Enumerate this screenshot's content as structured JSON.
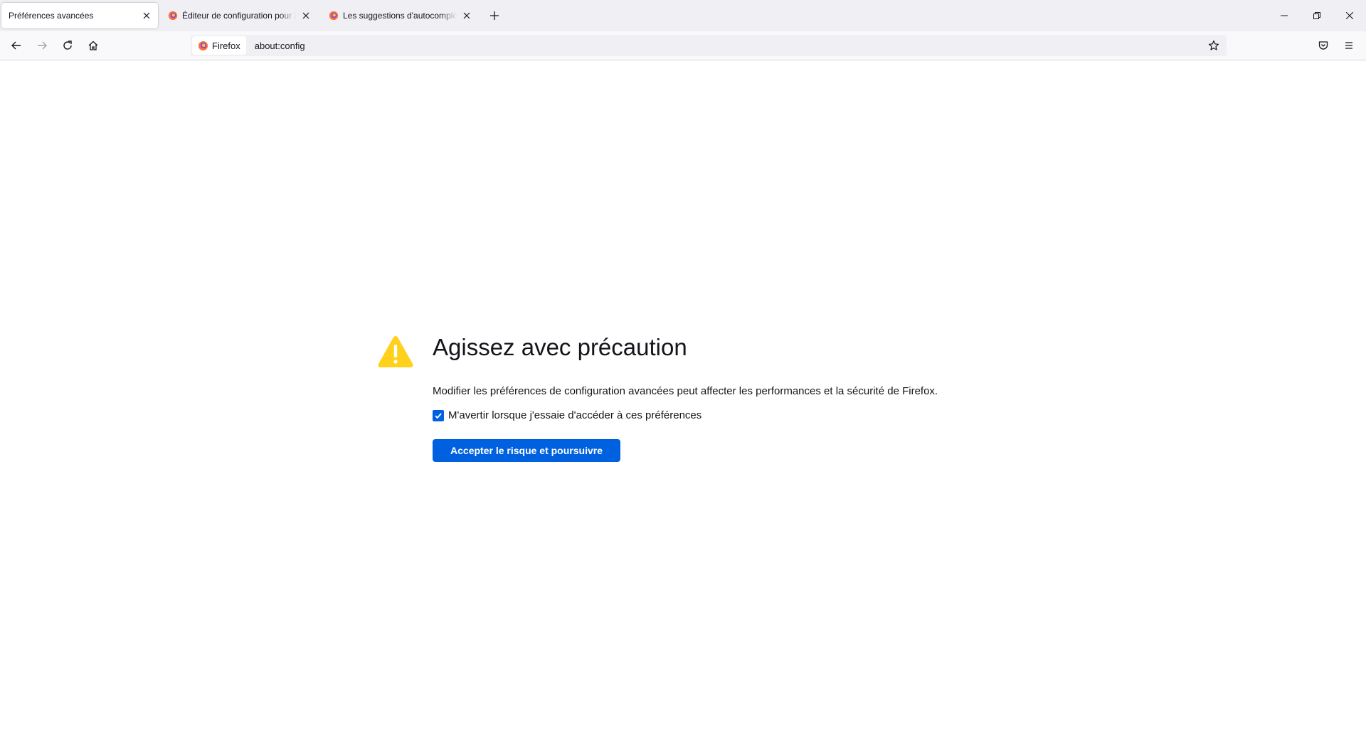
{
  "browser": {
    "tabs": [
      {
        "label": "Préférences avancées",
        "active": true,
        "favicon": "none"
      },
      {
        "label": "Éditeur de configuration pour Firefox",
        "active": false,
        "favicon": "firefox-icon"
      },
      {
        "label": "Les suggestions d'autocomplétion",
        "active": false,
        "favicon": "firefox-icon"
      }
    ],
    "new_tab_icon": "plus-icon",
    "window_controls": [
      "minimize-icon",
      "restore-icon",
      "close-icon"
    ]
  },
  "navbar": {
    "buttons": [
      "back-arrow-icon",
      "forward-arrow-icon",
      "reload-icon",
      "home-icon"
    ],
    "identity_label": "Firefox",
    "url": "about:config",
    "right_icons": [
      "bookmark-star-icon",
      "pocket-icon",
      "hamburger-menu-icon"
    ]
  },
  "page": {
    "icon": "warning-triangle-icon",
    "title": "Agissez avec précaution",
    "description": "Modifier les préférences de configuration avancées peut affecter les performances et la sécurité de Firefox.",
    "checkbox_label": "M'avertir lorsque j'essaie d'accéder à ces préférences",
    "checkbox_checked": true,
    "accept_button": "Accepter le risque et poursuivre"
  },
  "colors": {
    "accent": "#0061e0",
    "warning": "#ffd01c",
    "tabstrip_bg": "#f0f0f4"
  }
}
